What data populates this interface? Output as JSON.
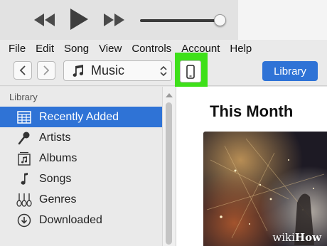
{
  "player": {
    "rewind_icon": "rewind-icon",
    "play_icon": "play-icon",
    "fast_forward_icon": "fast-forward-icon",
    "volume_level": 0.95
  },
  "menu": {
    "items": [
      {
        "label": "File"
      },
      {
        "label": "Edit"
      },
      {
        "label": "Song"
      },
      {
        "label": "View"
      },
      {
        "label": "Controls"
      },
      {
        "label": "Account"
      },
      {
        "label": "Help"
      }
    ]
  },
  "toolbar": {
    "media_select": "Music",
    "media_icon": "music-note-icon",
    "device_icon": "iphone-icon",
    "library_button": "Library",
    "highlight_color": "#3ee01a",
    "accent_color": "#2f73d6"
  },
  "sidebar": {
    "section_title": "Library",
    "items": [
      {
        "label": "Recently Added",
        "icon": "grid-icon",
        "active": true
      },
      {
        "label": "Artists",
        "icon": "microphone-icon",
        "active": false
      },
      {
        "label": "Albums",
        "icon": "album-icon",
        "active": false
      },
      {
        "label": "Songs",
        "icon": "music-note-icon",
        "active": false
      },
      {
        "label": "Genres",
        "icon": "guitars-icon",
        "active": false
      },
      {
        "label": "Downloaded",
        "icon": "download-icon",
        "active": false
      }
    ]
  },
  "main": {
    "heading": "This Month"
  },
  "watermark": {
    "prefix": "wiki",
    "suffix": "How"
  }
}
